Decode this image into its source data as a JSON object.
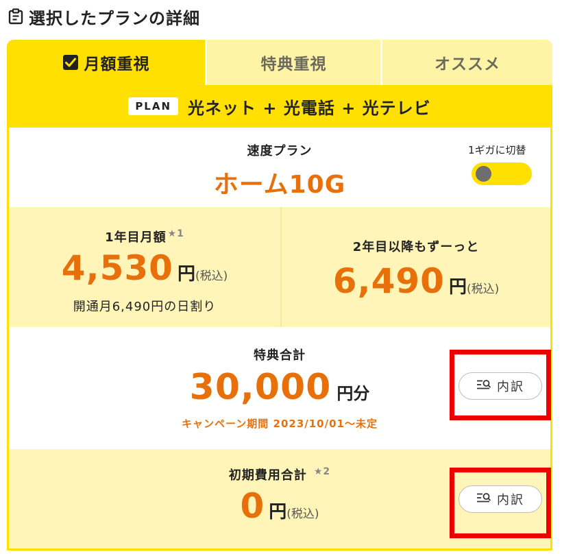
{
  "header": {
    "title": "選択したプランの詳細",
    "icon": "clipboard-icon"
  },
  "tabs": [
    {
      "label": "月額重視",
      "active": true
    },
    {
      "label": "特典重視",
      "active": false
    },
    {
      "label": "オススメ",
      "active": false
    }
  ],
  "plan": {
    "badge": "PLAN",
    "title": "光ネット + 光電話 + 光テレビ"
  },
  "speed": {
    "label": "速度プラン",
    "name": "ホーム10G",
    "toggle_label": "1ギガに切替",
    "toggle_on": false
  },
  "prices": {
    "first_year": {
      "label": "1年目月額",
      "note": "★1",
      "amount": "4,530",
      "unit": "円",
      "tax": "(税込)",
      "sub": "開通月6,490円の日割り"
    },
    "after": {
      "label": "2年目以降もずーっと",
      "amount": "6,490",
      "unit": "円",
      "tax": "(税込)"
    }
  },
  "benefit": {
    "label": "特典合計",
    "amount": "30,000",
    "unit": "円分",
    "campaign": "キャンペーン期間 2023/10/01〜未定",
    "detail_button": "内訳"
  },
  "initial_cost": {
    "label": "初期費用合計",
    "note": "★2",
    "amount": "0",
    "unit": "円",
    "tax": "(税込)",
    "detail_button": "内訳"
  },
  "colors": {
    "accent_yellow": "#ffe000",
    "light_yellow": "#fff5b8",
    "price_orange": "#e8700b",
    "highlight_red": "#ee0000"
  }
}
